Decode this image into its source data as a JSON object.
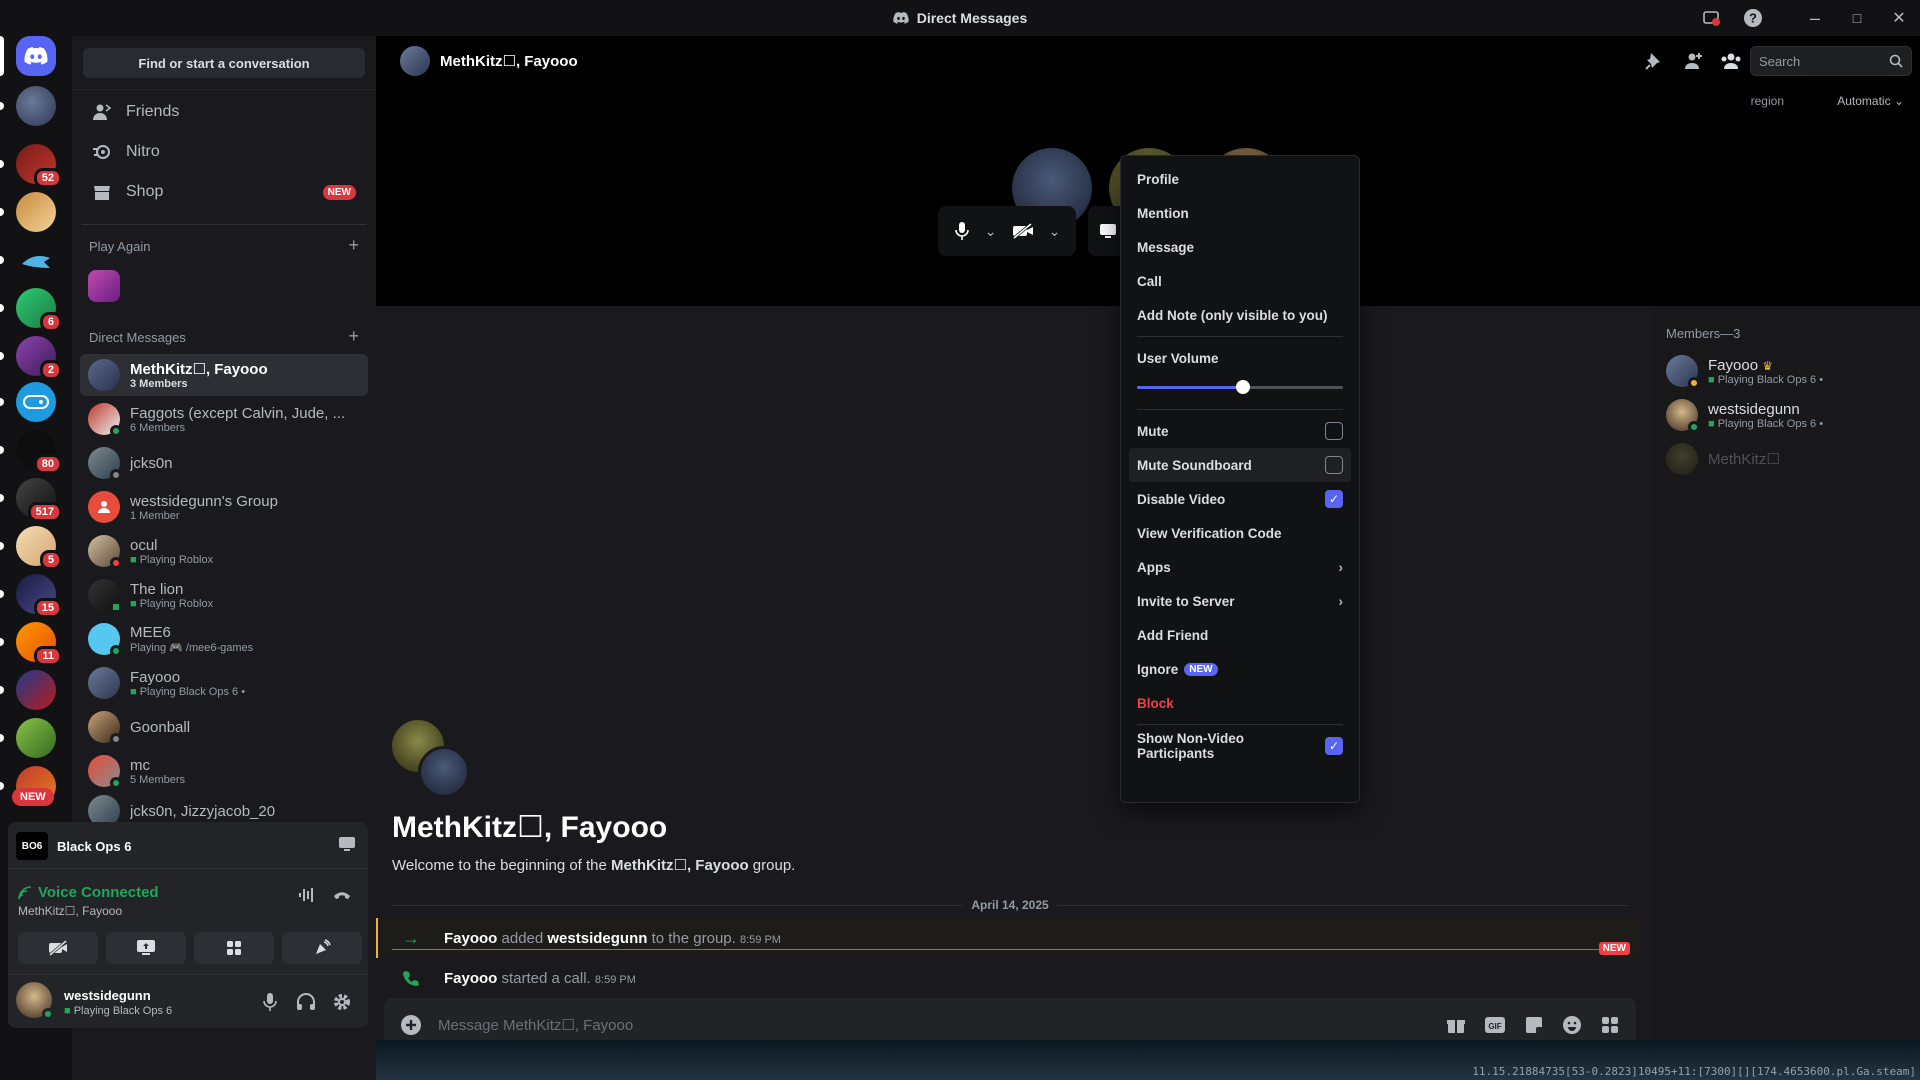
{
  "window": {
    "title": "Direct Messages"
  },
  "guild_badges": [
    "52",
    "6",
    "2",
    "80",
    "517",
    "5",
    "15",
    "11"
  ],
  "guild_new": "NEW",
  "dm_column": {
    "find_button": "Find or start a conversation",
    "nav": [
      {
        "label": "Friends"
      },
      {
        "label": "Nitro"
      },
      {
        "label": "Shop",
        "badge": "NEW"
      }
    ],
    "play_again": "Play Again",
    "direct_messages": "Direct Messages",
    "dms": [
      {
        "name": "MethKitz☐, Fayooo",
        "sub": "3 Members",
        "active": true
      },
      {
        "name": "Faggots (except Calvin, Jude, ...",
        "sub": "6 Members"
      },
      {
        "name": "jcks0n",
        "sub": ""
      },
      {
        "name": "westsidegunn's Group",
        "sub": "1 Member"
      },
      {
        "name": "ocul",
        "sub": "Playing Roblox"
      },
      {
        "name": "The lion",
        "sub": "Playing Roblox"
      },
      {
        "name": "MEE6",
        "sub": "Playing 🎮 /mee6-games"
      },
      {
        "name": "Fayooo",
        "sub": "Playing Black Ops 6 •"
      },
      {
        "name": "Goonball",
        "sub": ""
      },
      {
        "name": "mc",
        "sub": "5 Members"
      },
      {
        "name": "jcks0n, Jizzyjacob_20",
        "sub": ""
      }
    ]
  },
  "voice_panel": {
    "activity": "Black Ops 6",
    "game_logo": "BO6",
    "status": "Voice Connected",
    "channel": "MethKitz☐, Fayooo"
  },
  "user_panel": {
    "name": "westsidegunn",
    "activity": "Playing Black Ops 6"
  },
  "header": {
    "title": "MethKitz☐, Fayooo",
    "search_placeholder": "Search"
  },
  "call": {
    "region_label": "region",
    "region_value": "Automatic"
  },
  "chat": {
    "title": "MethKitz☐, Fayooo",
    "welcome_prefix": "Welcome to the beginning of the ",
    "welcome_group": "MethKitz☐, Fayooo",
    "welcome_suffix": " group.",
    "date_divider": "April 14, 2025",
    "messages": [
      {
        "actor": "Fayooo",
        "verb": " added ",
        "target": "westsidegunn",
        "rest": " to the group.",
        "time": "8:59 PM"
      },
      {
        "actor": "Fayooo",
        "verb": " started a call.",
        "target": "",
        "rest": "",
        "time": "8:59 PM"
      }
    ],
    "new_label": "NEW",
    "input_placeholder": "Message MethKitz☐, Fayooo"
  },
  "members": {
    "header": "Members—3",
    "list": [
      {
        "name": "Fayooo",
        "activity": "Playing Black Ops 6 •"
      },
      {
        "name": "westsidegunn",
        "activity": "Playing Black Ops 6 •"
      },
      {
        "name": "MethKitz☐",
        "activity": ""
      }
    ]
  },
  "context_menu": {
    "profile": "Profile",
    "mention": "Mention",
    "message": "Message",
    "call": "Call",
    "add_note": "Add Note (only visible to you)",
    "user_volume": "User Volume",
    "volume_value": 0.51,
    "mute": "Mute",
    "mute_soundboard": "Mute Soundboard",
    "disable_video": "Disable Video",
    "view_verification": "View Verification Code",
    "apps": "Apps",
    "invite": "Invite to Server",
    "add_friend": "Add Friend",
    "ignore": "Ignore",
    "ignore_badge": "NEW",
    "block": "Block",
    "show_non_video": "Show Non-Video Participants"
  },
  "taskbar_text": "11.15.21884735[53-0.2823]10495+11:[7300][][174.4653600.pl.Ga.steam]",
  "colors": {
    "accent": "#5865f2",
    "green": "#23a55a",
    "red": "#da373c",
    "danger_text": "#f23f43"
  }
}
